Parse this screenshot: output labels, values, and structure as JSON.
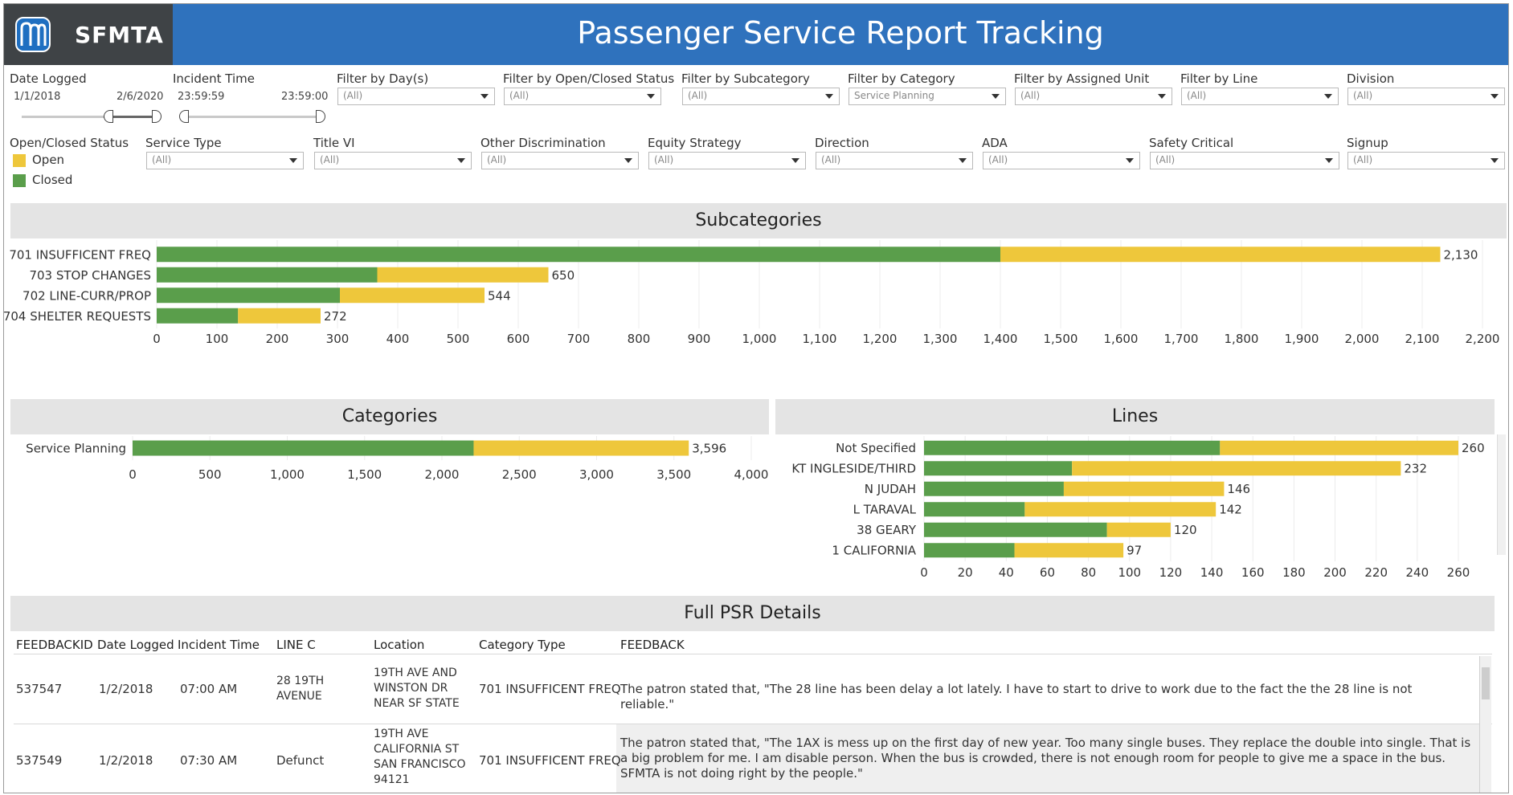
{
  "header": {
    "brand": "SFMTA",
    "title": "Passenger Service Report Tracking"
  },
  "filters_row1": {
    "date_logged": {
      "label": "Date Logged",
      "start": "1/1/2018",
      "end": "2/6/2020"
    },
    "incident_time": {
      "label": "Incident Time",
      "start": "23:59:59",
      "end": "23:59:00"
    },
    "dropdowns": [
      {
        "label": "Filter by Day(s)",
        "value": "(All)"
      },
      {
        "label": "Filter by Open/Closed Status",
        "value": "(All)"
      },
      {
        "label": "Filter by Subcategory",
        "value": "(All)"
      },
      {
        "label": "Filter by Category",
        "value": "Service Planning"
      },
      {
        "label": "Filter by Assigned Unit",
        "value": "(All)"
      },
      {
        "label": "Filter by Line",
        "value": "(All)"
      },
      {
        "label": "Division",
        "value": "(All)"
      }
    ]
  },
  "filters_row2": {
    "legend": {
      "label": "Open/Closed Status",
      "open": "Open",
      "closed": "Closed"
    },
    "dropdowns": [
      {
        "label": "Service Type",
        "value": "(All)"
      },
      {
        "label": "Title VI",
        "value": "(All)"
      },
      {
        "label": "Other Discrimination",
        "value": "(All)"
      },
      {
        "label": "Equity Strategy",
        "value": "(All)"
      },
      {
        "label": "Direction",
        "value": "(All)"
      },
      {
        "label": "ADA",
        "value": "(All)"
      },
      {
        "label": "Safety Critical",
        "value": "(All)"
      },
      {
        "label": "Signup",
        "value": "(All)"
      }
    ]
  },
  "colors": {
    "closed": "#5a9e4b",
    "open": "#eec73b",
    "header": "#2f72bd"
  },
  "sections": {
    "subcategories": "Subcategories",
    "categories": "Categories",
    "lines": "Lines",
    "details": "Full PSR Details"
  },
  "chart_data": [
    {
      "type": "bar",
      "title": "Subcategories",
      "orientation": "horizontal",
      "stacked": true,
      "categories": [
        "701 INSUFFICENT FREQ",
        "703 STOP CHANGES",
        "702 LINE-CURR/PROP",
        "704 SHELTER REQUESTS"
      ],
      "series": [
        {
          "name": "Closed",
          "values": [
            1400,
            366,
            304,
            135
          ]
        },
        {
          "name": "Open",
          "values": [
            730,
            284,
            240,
            137
          ]
        }
      ],
      "totals": [
        "2,130",
        "650",
        "544",
        "272"
      ],
      "xlim": [
        0,
        2200
      ],
      "xticks": [
        "0",
        "100",
        "200",
        "300",
        "400",
        "500",
        "600",
        "700",
        "800",
        "900",
        "1,000",
        "1,100",
        "1,200",
        "1,300",
        "1,400",
        "1,500",
        "1,600",
        "1,700",
        "1,800",
        "1,900",
        "2,000",
        "2,100",
        "2,200"
      ],
      "grid": true
    },
    {
      "type": "bar",
      "title": "Categories",
      "orientation": "horizontal",
      "stacked": true,
      "categories": [
        "Service Planning"
      ],
      "series": [
        {
          "name": "Closed",
          "values": [
            2205
          ]
        },
        {
          "name": "Open",
          "values": [
            1391
          ]
        }
      ],
      "totals": [
        "3,596"
      ],
      "xlim": [
        0,
        4000
      ],
      "xticks": [
        "0",
        "500",
        "1,000",
        "1,500",
        "2,000",
        "2,500",
        "3,000",
        "3,500",
        "4,000"
      ],
      "grid": true
    },
    {
      "type": "bar",
      "title": "Lines",
      "orientation": "horizontal",
      "stacked": true,
      "categories": [
        "Not Specified",
        "KT INGLESIDE/THIRD",
        "N JUDAH",
        "L TARAVAL",
        "38 GEARY",
        "1 CALIFORNIA"
      ],
      "series": [
        {
          "name": "Closed",
          "values": [
            144,
            72,
            68,
            49,
            89,
            44
          ]
        },
        {
          "name": "Open",
          "values": [
            116,
            160,
            78,
            93,
            31,
            53
          ]
        }
      ],
      "totals": [
        "260",
        "232",
        "146",
        "142",
        "120",
        "97"
      ],
      "xlim": [
        0,
        260
      ],
      "xticks": [
        "0",
        "20",
        "40",
        "60",
        "80",
        "100",
        "120",
        "140",
        "160",
        "180",
        "200",
        "220",
        "240",
        "260"
      ],
      "grid": true
    }
  ],
  "table": {
    "columns": [
      "FEEDBACKID",
      "Date Logged",
      "Incident Time",
      "LINE C",
      "Location",
      "Category Type",
      "FEEDBACK"
    ],
    "rows": [
      {
        "id": "537547",
        "date": "1/2/2018",
        "time": "07:00 AM",
        "line": "28 19TH AVENUE",
        "location": "19TH AVE AND WINSTON DR NEAR SF STATE",
        "category": "701 INSUFFICENT FREQ",
        "feedback": "The patron stated that, \"The 28 line has been delay a lot lately. I have to start to drive to work due to the fact the the 28 line is not reliable.\""
      },
      {
        "id": "537549",
        "date": "1/2/2018",
        "time": "07:30 AM",
        "line": "Defunct",
        "location": "19TH AVE CALIFORNIA ST SAN FRANCISCO 94121",
        "category": "701 INSUFFICENT FREQ",
        "feedback": "The patron stated that, \"The 1AX is mess up on the first day of new year. Too many single buses. They replace the double into single. That is a big problem for me. I am disable person. When the bus is crowded, there is not enough room for people to give me a space in the bus. SFMTA is not doing right by the people.\""
      }
    ]
  }
}
